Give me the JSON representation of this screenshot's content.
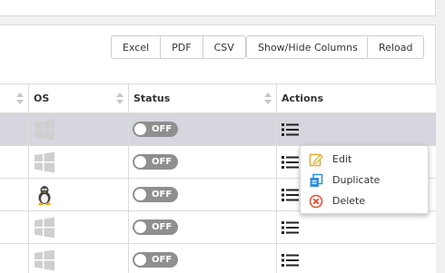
{
  "toolbar": {
    "export_buttons": [
      "Excel",
      "PDF",
      "CSV"
    ],
    "columns_label": "Show/Hide Columns",
    "reload_label": "Reload"
  },
  "table": {
    "headers": {
      "os": "OS",
      "status": "Status",
      "actions": "Actions"
    },
    "rows": [
      {
        "os": "windows-icon",
        "status": "OFF",
        "selected": true
      },
      {
        "os": "windows-icon",
        "status": "OFF",
        "selected": false
      },
      {
        "os": "linux-icon",
        "status": "OFF",
        "selected": false
      },
      {
        "os": "windows-icon",
        "status": "OFF",
        "selected": false
      },
      {
        "os": "windows-icon",
        "status": "OFF",
        "selected": false
      }
    ]
  },
  "context_menu": {
    "items": [
      {
        "label": "Edit",
        "icon": "edit-icon",
        "color": "#e8a82a"
      },
      {
        "label": "Duplicate",
        "icon": "duplicate-icon",
        "color": "#2f8fd6"
      },
      {
        "label": "Delete",
        "icon": "delete-icon",
        "color": "#e0492f"
      }
    ]
  },
  "colors": {
    "selected_row": "#d6d6de",
    "toggle_off": "#8f8f8f",
    "os_icon": "#cfcfcf"
  }
}
